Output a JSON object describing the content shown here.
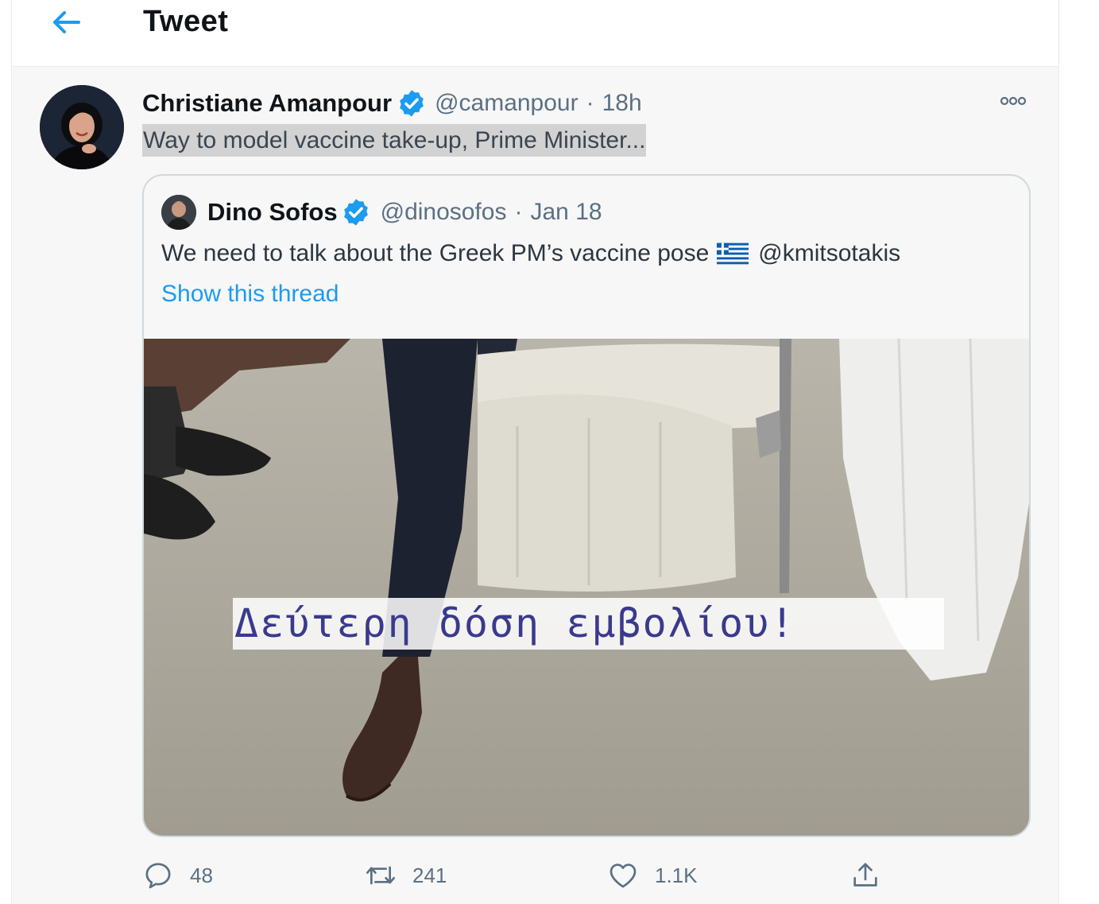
{
  "header": {
    "title": "Tweet",
    "back_icon": "arrow-left-icon"
  },
  "tweet": {
    "display_name": "Christiane Amanpour",
    "handle": "@camanpour",
    "separator": "·",
    "time": "18h",
    "text": "Way to model vaccine take-up, Prime Minister...",
    "more_icon": "more-options-icon"
  },
  "quote": {
    "display_name": "Dino Sofos",
    "handle": "@dinosofos",
    "separator": "·",
    "date": "Jan 18",
    "text_before": "We need to talk about the Greek PM’s vaccine pose",
    "text_mention": "@kmitsotakis",
    "show_thread": "Show this thread",
    "media_caption": "Δεύτερη δόση εμβολίου!"
  },
  "actions": {
    "replies": "48",
    "retweets": "241",
    "likes": "1.1K"
  },
  "colors": {
    "accent": "#1d9bf0",
    "text_primary": "#0f1419",
    "text_secondary": "#5b7083",
    "highlight": "#d2d2d2"
  }
}
